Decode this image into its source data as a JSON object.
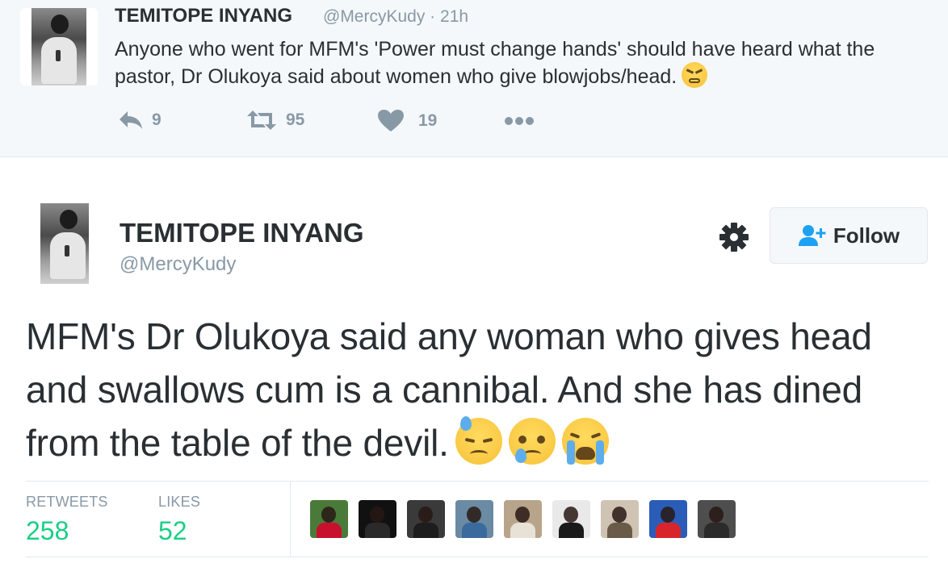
{
  "parent_tweet": {
    "name": "TEMITOPE INYANG",
    "handle": "@MercyKudy · 21h",
    "text": "Anyone who went for MFM's 'Power must change hands' should have heard what the pastor, Dr Olukoya said about women who give blowjobs/head.",
    "emoji": "persevering-face",
    "actions": {
      "replies": "9",
      "retweets": "95",
      "likes": "19"
    }
  },
  "main_tweet": {
    "name": "TEMITOPE INYANG",
    "handle": "@MercyKudy",
    "follow_label": "Follow",
    "text": "MFM's Dr Olukoya said any woman who gives head and swallows cum is a cannibal. And she has dined from the table of the devil.",
    "emojis": [
      "downcast-face-with-sweat",
      "crying-face",
      "loudly-crying-face"
    ],
    "stats": {
      "retweets_label": "RETWEETS",
      "retweets_value": "258",
      "likes_label": "LIKES",
      "likes_value": "52"
    },
    "likers": [
      {
        "bg": "#4a7a3a",
        "body": "#c8102e"
      },
      {
        "bg": "#111111",
        "body": "#2a2a2a"
      },
      {
        "bg": "#3a3a3a",
        "body": "#1d1d1d"
      },
      {
        "bg": "#6b8aa3",
        "body": "#3b6b9c"
      },
      {
        "bg": "#b8a48a",
        "body": "#e8e1d6"
      },
      {
        "bg": "#e9e9e9",
        "body": "#1a1a1a"
      },
      {
        "bg": "#cfc3b3",
        "body": "#6a5a48"
      },
      {
        "bg": "#2b5db8",
        "body": "#d8252b"
      },
      {
        "bg": "#4e4e4e",
        "body": "#2b2b2b"
      }
    ]
  },
  "colors": {
    "accent_green": "#19cf86",
    "muted": "#8899a6",
    "text": "#292f33"
  }
}
